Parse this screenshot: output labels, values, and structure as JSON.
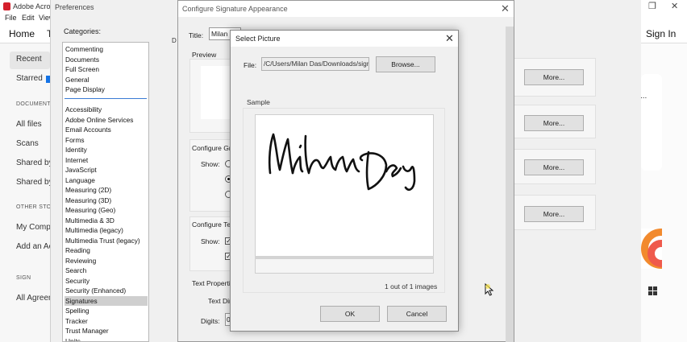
{
  "acrobat": {
    "title": "Adobe Acrobat",
    "menu": [
      "File",
      "Edit",
      "View"
    ],
    "tab_home": "Home",
    "tab_tools": "T",
    "sign_in": "Sign In",
    "sidebar": {
      "recent": "Recent",
      "starred": "Starred",
      "documents_head": "DOCUMENTS",
      "all_files": "All files",
      "scans": "Scans",
      "shared_by_you": "Shared by",
      "shared_by_others": "Shared by",
      "other_storage_head": "OTHER STORAGE",
      "my_computer": "My Compu",
      "add_account": "Add an Ac",
      "sign_head": "SIGN",
      "all_agreements": "All Agreem"
    },
    "right_dots": "...",
    "accent": "#1473e6"
  },
  "prefs": {
    "title": "Preferences",
    "categories_label": "Categories:",
    "d_label": "D",
    "top_items": [
      "Commenting",
      "Documents",
      "Full Screen",
      "General",
      "Page Display"
    ],
    "items": [
      "Accessibility",
      "Adobe Online Services",
      "Email Accounts",
      "Forms",
      "Identity",
      "Internet",
      "JavaScript",
      "Language",
      "Measuring (2D)",
      "Measuring (3D)",
      "Measuring (Geo)",
      "Multimedia & 3D",
      "Multimedia (legacy)",
      "Multimedia Trust (legacy)",
      "Reading",
      "Reviewing",
      "Search",
      "Security",
      "Security (Enhanced)",
      "Signatures",
      "Spelling",
      "Tracker",
      "Trust Manager",
      "Units"
    ],
    "selected": "Signatures",
    "more_buttons": [
      "More...",
      "More...",
      "More...",
      "More..."
    ]
  },
  "csa": {
    "title": "Configure Signature Appearance",
    "title_label": "Title:",
    "title_value": "Milan D",
    "preview_label": "Preview",
    "configure_graphic": "Configure Gra",
    "show_label": "Show:",
    "configure_text": "Configure Text",
    "show_label2": "Show:",
    "text_properties": "Text Properties",
    "text_direction": "Text Dire",
    "digits_label": "Digits:",
    "digits_value": "0"
  },
  "select_picture": {
    "title": "Select Picture",
    "file_label": "File:",
    "file_value": "/C/Users/Milan Das/Downloads/sign",
    "browse": "Browse...",
    "sample_label": "Sample",
    "image_count": "1 out of 1 images",
    "ok": "OK",
    "cancel": "Cancel"
  }
}
